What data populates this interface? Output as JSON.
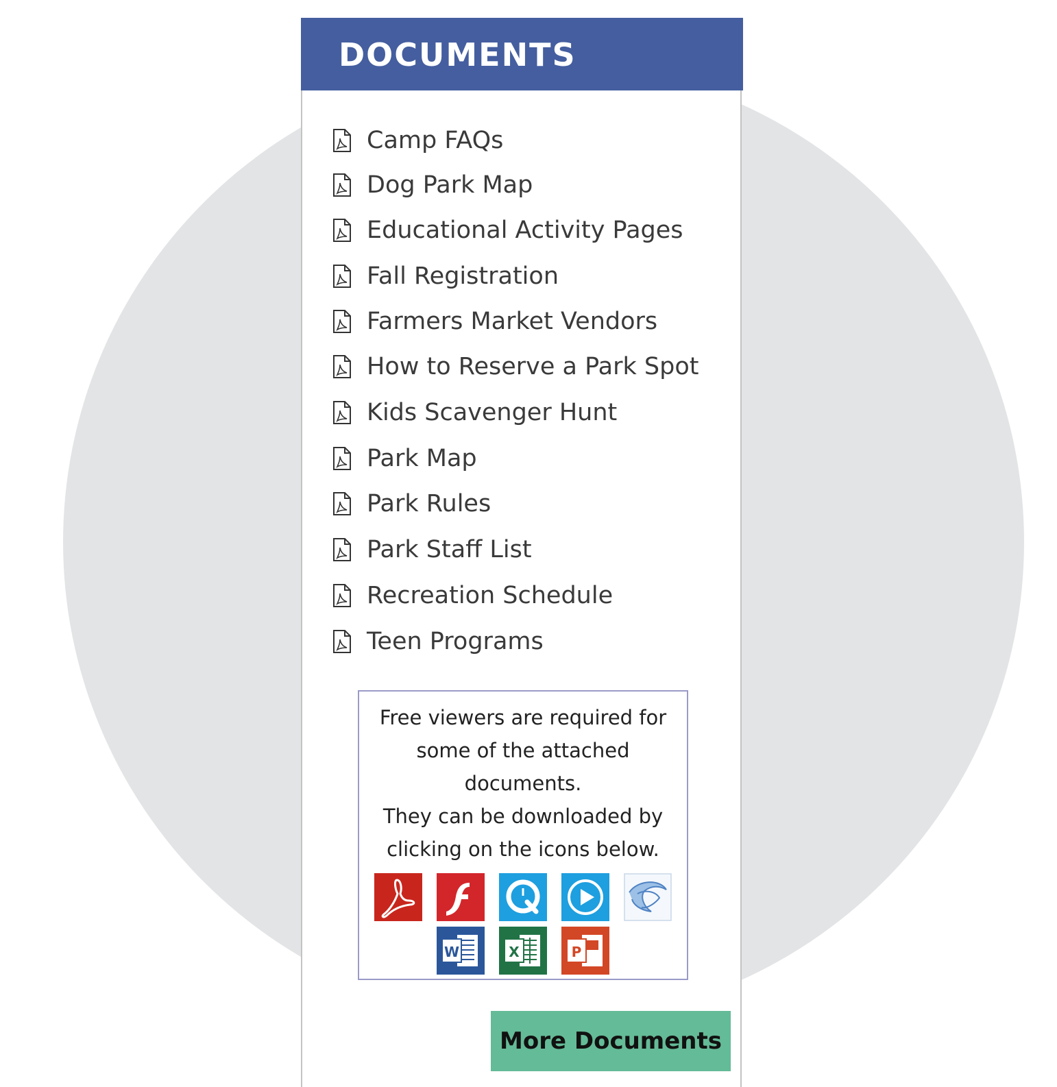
{
  "widget": {
    "title": "DOCUMENTS"
  },
  "documents": [
    {
      "label": "Camp FAQs",
      "icon": "pdf-file-icon"
    },
    {
      "label": "Dog Park Map",
      "icon": "pdf-file-icon"
    },
    {
      "label": "Educational Activity Pages",
      "icon": "pdf-file-icon"
    },
    {
      "label": "Fall Registration",
      "icon": "pdf-file-icon"
    },
    {
      "label": "Farmers Market Vendors",
      "icon": "pdf-file-icon"
    },
    {
      "label": "How to Reserve a Park Spot",
      "icon": "pdf-file-icon"
    },
    {
      "label": "Kids Scavenger Hunt",
      "icon": "pdf-file-icon"
    },
    {
      "label": "Park Map",
      "icon": "pdf-file-icon"
    },
    {
      "label": "Park Rules",
      "icon": "pdf-file-icon"
    },
    {
      "label": "Park Staff List",
      "icon": "pdf-file-icon"
    },
    {
      "label": "Recreation Schedule",
      "icon": "pdf-file-icon"
    },
    {
      "label": "Teen Programs",
      "icon": "pdf-file-icon"
    }
  ],
  "viewers": {
    "lines": [
      "Free viewers are required for",
      "some of the attached",
      "documents.",
      "They can be downloaded by",
      "clicking on the icons below."
    ],
    "icons": [
      {
        "name": "adobe-reader-icon",
        "color": "#c8261d"
      },
      {
        "name": "flash-player-icon",
        "color": "#d3262b"
      },
      {
        "name": "quicktime-icon",
        "color": "#1e9fdf"
      },
      {
        "name": "windows-media-player-icon",
        "color": "#1e9fdf"
      },
      {
        "name": "silverlight-icon",
        "color": "#5b8fd0"
      },
      {
        "name": "word-viewer-icon",
        "color": "#2b579a"
      },
      {
        "name": "excel-viewer-icon",
        "color": "#217346"
      },
      {
        "name": "powerpoint-viewer-icon",
        "color": "#d24726"
      }
    ]
  },
  "more_button": {
    "label": "More Documents"
  },
  "colors": {
    "header": "#445e9f",
    "button": "#64bb97",
    "background_circle": "#e3e4e6",
    "link_text": "#3a3a3a"
  }
}
